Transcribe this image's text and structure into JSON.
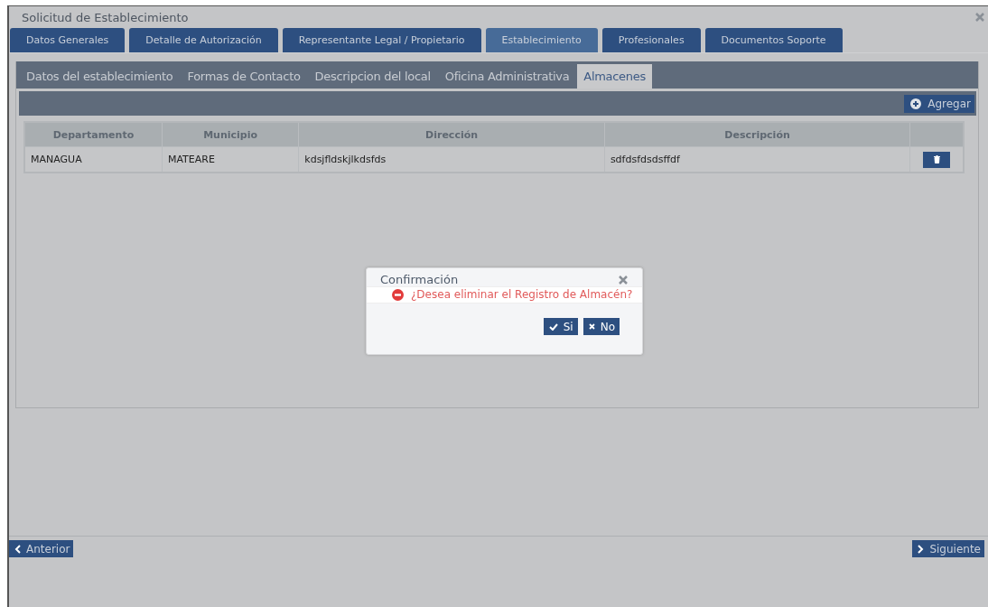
{
  "window": {
    "title": "Solicitud de Establecimiento"
  },
  "tabs": [
    {
      "label": "Datos Generales",
      "selected": false
    },
    {
      "label": "Detalle de Autorización",
      "selected": false
    },
    {
      "label": "Representante Legal / Propietario",
      "selected": false
    },
    {
      "label": "Establecimiento",
      "selected": true
    },
    {
      "label": "Profesionales",
      "selected": false
    },
    {
      "label": "Documentos Soporte",
      "selected": false
    }
  ],
  "subtabs": [
    {
      "label": "Datos del establecimiento",
      "selected": false
    },
    {
      "label": "Formas de Contacto",
      "selected": false
    },
    {
      "label": "Descripcion del local",
      "selected": false
    },
    {
      "label": "Oficina Administrativa",
      "selected": false
    },
    {
      "label": "Almacenes",
      "selected": true
    }
  ],
  "toolbar": {
    "add_button": "Agregar"
  },
  "table": {
    "columns": [
      "Departamento",
      "Municipio",
      "Dirección",
      "Descripción"
    ],
    "rows": [
      [
        "MANAGUA",
        "MATEARE",
        "kdsjfldskjlkdsfds",
        "sdfdsfdsdsffdf"
      ]
    ]
  },
  "dialog": {
    "title": "Confirmación",
    "message": "¿Desea eliminar el Registro de Almacén?",
    "buttons": [
      {
        "label": "Si",
        "kind": "confirm"
      },
      {
        "label": "No",
        "kind": "cancel"
      }
    ]
  },
  "footer": {
    "back_button": "Anterior",
    "next_button": "Siguiente"
  }
}
